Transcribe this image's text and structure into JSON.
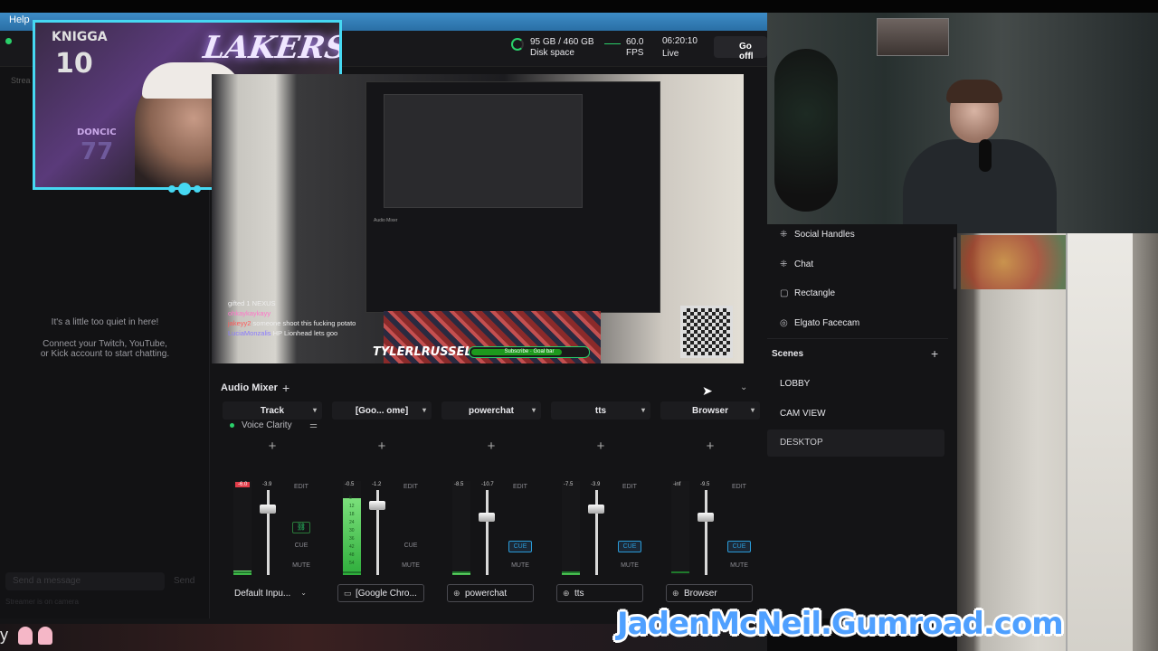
{
  "app": {
    "menu_help": "Help"
  },
  "header": {
    "disk_value": "95 GB / 460 GB",
    "disk_label": "Disk space",
    "fps_value": "60.0",
    "fps_label": "FPS",
    "time_value": "06:20:10",
    "time_label": "Live",
    "go_offline": "Go offl"
  },
  "chat": {
    "stream_label": "Strea",
    "quiet_line": "It's a little too quiet in here!",
    "connect_line1": "Connect your Twitch, YouTube,",
    "connect_line2": "or Kick account to start chatting.",
    "input_placeholder": "Send a message",
    "send_label": "Send",
    "note": "Streamer is on camera"
  },
  "cam_overlay": {
    "lakers": "LAKERS",
    "jersey_name": "KNIGGA",
    "jersey_num": "10",
    "jersey2_name": "DONCIC",
    "jersey2_num": "77"
  },
  "preview": {
    "chat_lines": [
      {
        "name": "gifted 1 NEXUS",
        "text": ""
      },
      {
        "name": "ohkaykaykayy",
        "text": ""
      },
      {
        "name": "jakeyy2",
        "text": "someone shoot this fucking potato"
      },
      {
        "name": "LuciaMonzalis",
        "text": "HP Lionhead lets goo"
      }
    ],
    "streamer_name": "TYLERLRUSSELL",
    "goal_bar": "Subscribe · Goal bar"
  },
  "mixer": {
    "title": "Audio Mixer",
    "add": "+",
    "channels": [
      {
        "name": "Track",
        "voice": "Voice Clarity",
        "db_left": "-6.0",
        "db_right": "-3.9",
        "level": 0.05,
        "fader": 0.86,
        "cue_active": false,
        "has_link": true,
        "source": "Default Inpu...",
        "source_icon": "",
        "source_has_chev": true
      },
      {
        "name": "[Goo... ome]",
        "voice": "",
        "db_left": "-0.5",
        "db_right": "-1.2",
        "level": 0.82,
        "fader": 0.9,
        "cue_active": false,
        "has_link": false,
        "source": "[Google Chro...",
        "source_icon": "▭",
        "source_has_chev": false,
        "meter_scale": [
          "6",
          "12",
          "18",
          "24",
          "30",
          "36",
          "42",
          "48",
          "54"
        ]
      },
      {
        "name": "powerchat",
        "voice": "",
        "db_left": "-8.5",
        "db_right": "-10.7",
        "level": 0.02,
        "fader": 0.77,
        "cue_active": true,
        "has_link": false,
        "source": "powerchat",
        "source_icon": "⊕",
        "source_has_chev": false
      },
      {
        "name": "tts",
        "voice": "",
        "db_left": "-7.5",
        "db_right": "-3.9",
        "level": 0.03,
        "fader": 0.86,
        "cue_active": true,
        "has_link": false,
        "source": "tts",
        "source_icon": "⊕",
        "source_has_chev": false
      },
      {
        "name": "Browser",
        "voice": "",
        "db_left": "-inf",
        "db_right": "-9.5",
        "level": 0.0,
        "fader": 0.77,
        "cue_active": true,
        "has_link": false,
        "source": "Browser",
        "source_icon": "⊕",
        "source_has_chev": false
      }
    ],
    "btn_edit": "EDIT",
    "btn_cue": "CUE",
    "btn_mute": "MUTE"
  },
  "sources": [
    {
      "label": "Social Handles",
      "icon": "⁜"
    },
    {
      "label": "Chat",
      "icon": "⁜"
    },
    {
      "label": "Rectangle",
      "icon": "▢"
    },
    {
      "label": "Elgato Facecam",
      "icon": "◎"
    }
  ],
  "scenes": {
    "title": "Scenes",
    "add": "+",
    "items": [
      {
        "label": "LOBBY",
        "active": false
      },
      {
        "label": "CAM VIEW",
        "active": false
      },
      {
        "label": "DESKTOP",
        "active": true
      }
    ]
  },
  "overlay": {
    "gumroad": "JadenMcNeil.Gumroad.com",
    "y_letter": "y"
  },
  "colors": {
    "accent": "#46d8f2",
    "live_green": "#2ad06a",
    "cue_blue": "#2a9bd8",
    "gumroad_blue": "#4fa0ff"
  }
}
